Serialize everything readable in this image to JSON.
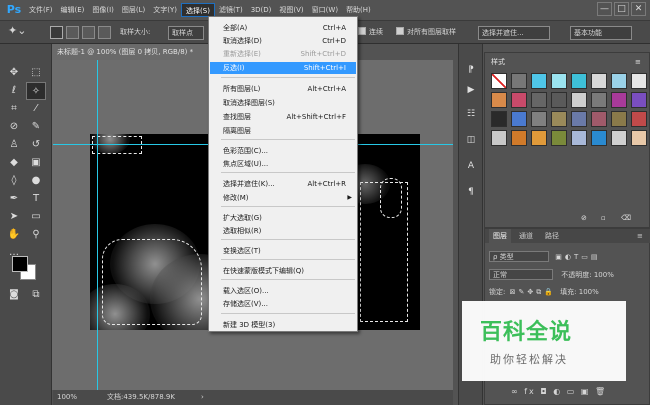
{
  "app": {
    "logo": "Ps"
  },
  "menubar": {
    "items": [
      "文件(F)",
      "编辑(E)",
      "图像(I)",
      "图层(L)",
      "文字(Y)",
      "选择(S)",
      "滤镜(T)",
      "3D(D)",
      "视图(V)",
      "窗口(W)",
      "帮助(H)"
    ],
    "active_index": 5,
    "window_controls": [
      "—",
      "□",
      "✕"
    ]
  },
  "options": {
    "feather_label": "羽化",
    "sample_size_label": "取样大小:",
    "sample_size_value": "取样点",
    "contiguous_label": "连续",
    "all_layers_label": "对所有图层取样",
    "select_mask_button": "选择并遮住...",
    "workspace_value": "基本功能"
  },
  "document": {
    "tab_title": "未标题-1 @ 100% (图层 0 拷贝, RGB/8) *",
    "zoom": "100%",
    "doc_info": "文档:439.5K/878.9K"
  },
  "select_menu": {
    "items": [
      {
        "label": "全部(A)",
        "shortcut": "Ctrl+A",
        "state": "normal"
      },
      {
        "label": "取消选择(D)",
        "shortcut": "Ctrl+D",
        "state": "normal"
      },
      {
        "label": "重新选择(E)",
        "shortcut": "Shift+Ctrl+D",
        "state": "disabled"
      },
      {
        "label": "反选(I)",
        "shortcut": "Shift+Ctrl+I",
        "state": "highlighted"
      },
      {
        "label": "所有图层(L)",
        "shortcut": "Alt+Ctrl+A",
        "state": "normal"
      },
      {
        "label": "取消选择图层(S)",
        "shortcut": "",
        "state": "normal"
      },
      {
        "label": "查找图层",
        "shortcut": "Alt+Shift+Ctrl+F",
        "state": "normal"
      },
      {
        "label": "隔离图层",
        "shortcut": "",
        "state": "normal"
      },
      {
        "label": "色彩范围(C)...",
        "shortcut": "",
        "state": "normal"
      },
      {
        "label": "焦点区域(U)...",
        "shortcut": "",
        "state": "normal"
      },
      {
        "label": "选择并遮住(K)...",
        "shortcut": "Alt+Ctrl+R",
        "state": "normal"
      },
      {
        "label": "修改(M)",
        "shortcut": "",
        "state": "submenu"
      },
      {
        "label": "扩大选取(G)",
        "shortcut": "",
        "state": "normal"
      },
      {
        "label": "选取相似(R)",
        "shortcut": "",
        "state": "normal"
      },
      {
        "label": "变换选区(T)",
        "shortcut": "",
        "state": "normal"
      },
      {
        "label": "在快速蒙版模式下编辑(Q)",
        "shortcut": "",
        "state": "normal"
      },
      {
        "label": "载入选区(O)...",
        "shortcut": "",
        "state": "normal"
      },
      {
        "label": "存储选区(V)...",
        "shortcut": "",
        "state": "normal"
      },
      {
        "label": "新建 3D 模型(3)",
        "shortcut": "",
        "state": "normal"
      }
    ]
  },
  "styles_panel": {
    "tab": "样式",
    "swatch_colors": [
      "#e8e8e8",
      "#777777",
      "#4fc6e8",
      "#9be4f0",
      "#3ec0d8",
      "#d8d8d8",
      "#9ad2e8",
      "#e6e6e6",
      "#d88a4a",
      "#c84a6a",
      "#666666",
      "#5a5a5a",
      "#cfcfcf",
      "#7a7a7a",
      "#a83a9a",
      "#7a4ec0",
      "#2a2a2a",
      "#4a7ad0",
      "#808080",
      "#9a8a5a",
      "#6a7aa8",
      "#a05a6a",
      "#8a7a4a",
      "#c04a4a",
      "#c8c8c8",
      "#d07a2a",
      "#e09a3a",
      "#7a8a3a",
      "#a8b8d8",
      "#2a8ad0",
      "#cfcfcf",
      "#e8c8a8"
    ]
  },
  "layers_panel": {
    "tabs": [
      "图层",
      "通道",
      "路径"
    ],
    "filter_label": "ρ 类型",
    "blend_mode": "正常",
    "opacity_label": "不透明度:",
    "opacity_value": "100%",
    "lock_label": "锁定:",
    "fill_label": "填充:",
    "fill_value": "100%",
    "footer_icons": [
      "∞",
      "fx",
      "◘",
      "◐",
      "▭",
      "▣",
      "🗑"
    ]
  },
  "watermark": {
    "main": "百科全说",
    "sub": "助你轻松解决"
  }
}
